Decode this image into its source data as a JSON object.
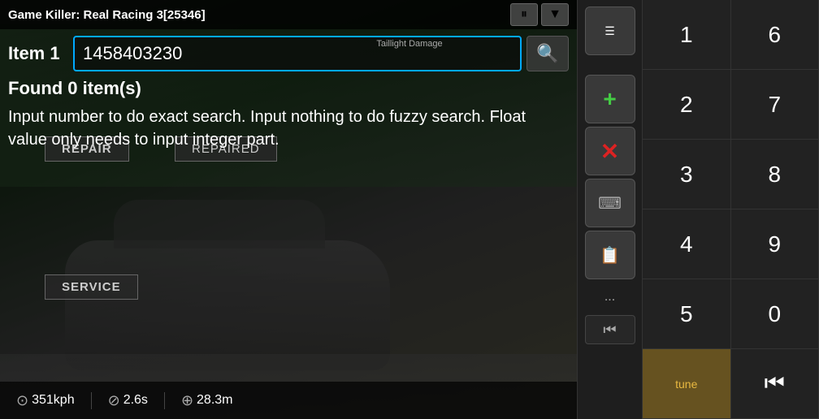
{
  "title_bar": {
    "title": "Game Killer: Real Racing 3[25346]",
    "pause_label": "⏸",
    "menu_label": "▼"
  },
  "search": {
    "item_label": "Item 1",
    "input_value": "1458403230",
    "input_placeholder": "",
    "hint_text": "Taillight Damage",
    "search_icon": "🔍"
  },
  "results": {
    "found_text": "Found 0 item(s)"
  },
  "help": {
    "text": "Input number to do exact search. Input nothing to do fuzzy search. Float value only needs to input integer part."
  },
  "game_labels": {
    "repair": "REPAIR",
    "repaired": "REPAIRED",
    "service": "SERVICE"
  },
  "bottom_stats": [
    {
      "icon": "⊙",
      "value": "351kph"
    },
    {
      "icon": "⊘",
      "value": "2.6s"
    },
    {
      "icon": "⊕",
      "value": "28.3m"
    }
  ],
  "numpad": {
    "keys": [
      "1",
      "6",
      "2",
      "7",
      "3",
      "8",
      "4",
      "9",
      "5",
      "0",
      "tune",
      "←"
    ]
  },
  "controls": {
    "list_icon": "☰",
    "plus_icon": "+",
    "cross_icon": "✕",
    "keyboard_icon": "⌨",
    "files_icon": "📋",
    "dots": "...",
    "back_icon": "⏮"
  }
}
